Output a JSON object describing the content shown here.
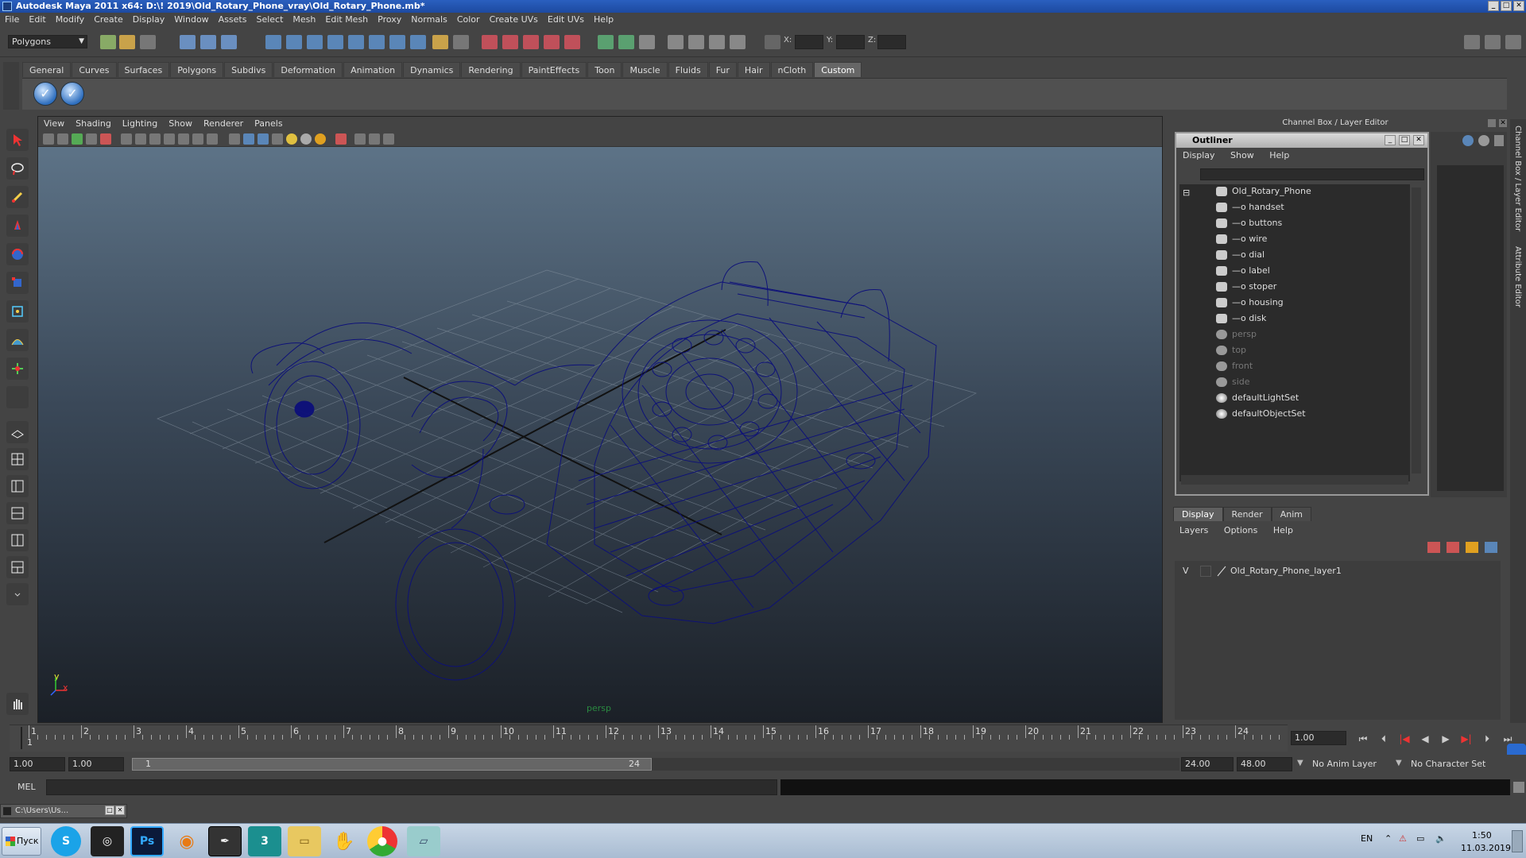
{
  "window": {
    "title": "Autodesk Maya 2011 x64: D:\\! 2019\\Old_Rotary_Phone_vray\\Old_Rotary_Phone.mb*",
    "minimize": "_",
    "maximize": "□",
    "close": "✕"
  },
  "menubar": [
    "File",
    "Edit",
    "Modify",
    "Create",
    "Display",
    "Window",
    "Assets",
    "Select",
    "Mesh",
    "Edit Mesh",
    "Proxy",
    "Normals",
    "Color",
    "Create UVs",
    "Edit UVs",
    "Help"
  ],
  "statusline": {
    "mode": "Polygons",
    "x_label": "X:",
    "y_label": "Y:",
    "z_label": "Z:"
  },
  "shelf": {
    "tabs": [
      "General",
      "Curves",
      "Surfaces",
      "Polygons",
      "Subdivs",
      "Deformation",
      "Animation",
      "Dynamics",
      "Rendering",
      "PaintEffects",
      "Toon",
      "Muscle",
      "Fluids",
      "Fur",
      "Hair",
      "nCloth",
      "Custom"
    ],
    "active_tab": "Custom"
  },
  "viewport": {
    "menu": [
      "View",
      "Shading",
      "Lighting",
      "Show",
      "Renderer",
      "Panels"
    ],
    "camera_label": "persp",
    "axis_x": "x",
    "axis_y": "y"
  },
  "channelbox": {
    "header": "Channel Box / Layer Editor",
    "side_tab_1": "Channel Box / Layer Editor",
    "side_tab_2": "Attribute Editor"
  },
  "outliner": {
    "title": "Outliner",
    "menu": [
      "Display",
      "Show",
      "Help"
    ],
    "root": "Old_Rotary_Phone",
    "children": [
      "handset",
      "buttons",
      "wire",
      "dial",
      "label",
      "stoper",
      "housing",
      "disk"
    ],
    "cameras": [
      "persp",
      "top",
      "front",
      "side"
    ],
    "sets": [
      "defaultLightSet",
      "defaultObjectSet"
    ]
  },
  "layer_editor": {
    "tabs": [
      "Display",
      "Render",
      "Anim"
    ],
    "active_tab": "Display",
    "menu": [
      "Layers",
      "Options",
      "Help"
    ],
    "layers": [
      {
        "visible": "V",
        "name": "Old_Rotary_Phone_layer1"
      }
    ]
  },
  "timeslider": {
    "ticks": [
      "1",
      "2",
      "3",
      "4",
      "5",
      "6",
      "7",
      "8",
      "9",
      "10",
      "11",
      "12",
      "13",
      "14",
      "15",
      "16",
      "17",
      "18",
      "19",
      "20",
      "21",
      "22",
      "23",
      "24"
    ],
    "current_frame": "1",
    "current_time": "1.00"
  },
  "rangeslider": {
    "start_time": "1.00",
    "playback_start": "1.00",
    "range_start": "1",
    "range_end": "24",
    "playback_end": "24.00",
    "end_time": "48.00",
    "anim_layer": "No Anim Layer",
    "character_set": "No Character Set"
  },
  "cmdline": {
    "label": "MEL"
  },
  "minimized_window": {
    "title": "C:\\Users\\Us..."
  },
  "taskbar": {
    "start": "Пуск",
    "apps": [
      "Skype",
      "Steam",
      "Ps",
      "Blender",
      "Inkscape",
      "3ds Max",
      "Explorer",
      "Hand",
      "Chrome",
      "Notes"
    ],
    "lang": "EN",
    "time": "1:50",
    "date": "11.03.2019"
  }
}
